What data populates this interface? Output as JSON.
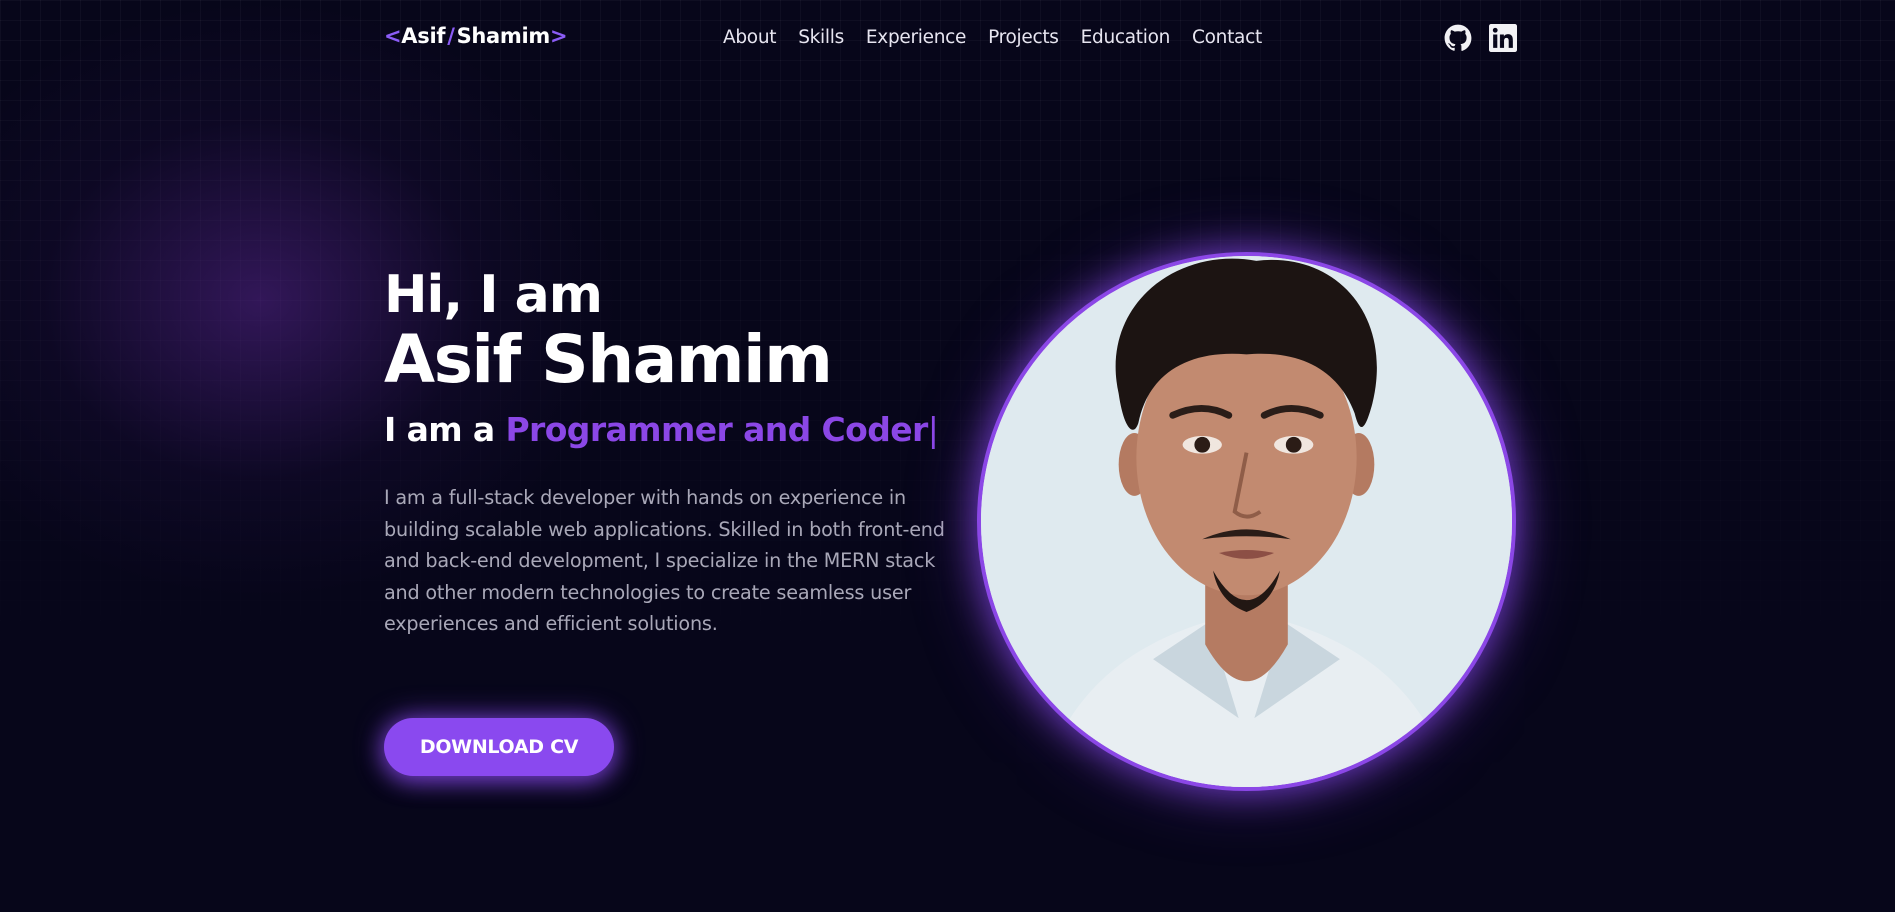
{
  "nav": {
    "logo": {
      "open": "<",
      "first": "Asif",
      "slash": "/",
      "last": "Shamim",
      "close": ">"
    },
    "links": [
      "About",
      "Skills",
      "Experience",
      "Projects",
      "Education",
      "Contact"
    ],
    "social": [
      {
        "icon": "github-icon"
      },
      {
        "icon": "linkedin-icon"
      }
    ]
  },
  "hero": {
    "greeting": "Hi, I am",
    "name": "Asif Shamim",
    "role_prefix": "I am a ",
    "role_highlight": "Programmer and Coder",
    "role_cursor": "|",
    "description": "I am a full-stack developer with hands on experience in building scalable web applications. Skilled in both front-end and back-end development, I specialize in the MERN stack and other modern technologies to create seamless user experiences and efficient solutions.",
    "cta_label": "DOWNLOAD CV"
  },
  "colors": {
    "background": "#07061a",
    "accent": "#8b47e6",
    "text": "#ffffff",
    "muted_text": "#a9a8b8"
  }
}
